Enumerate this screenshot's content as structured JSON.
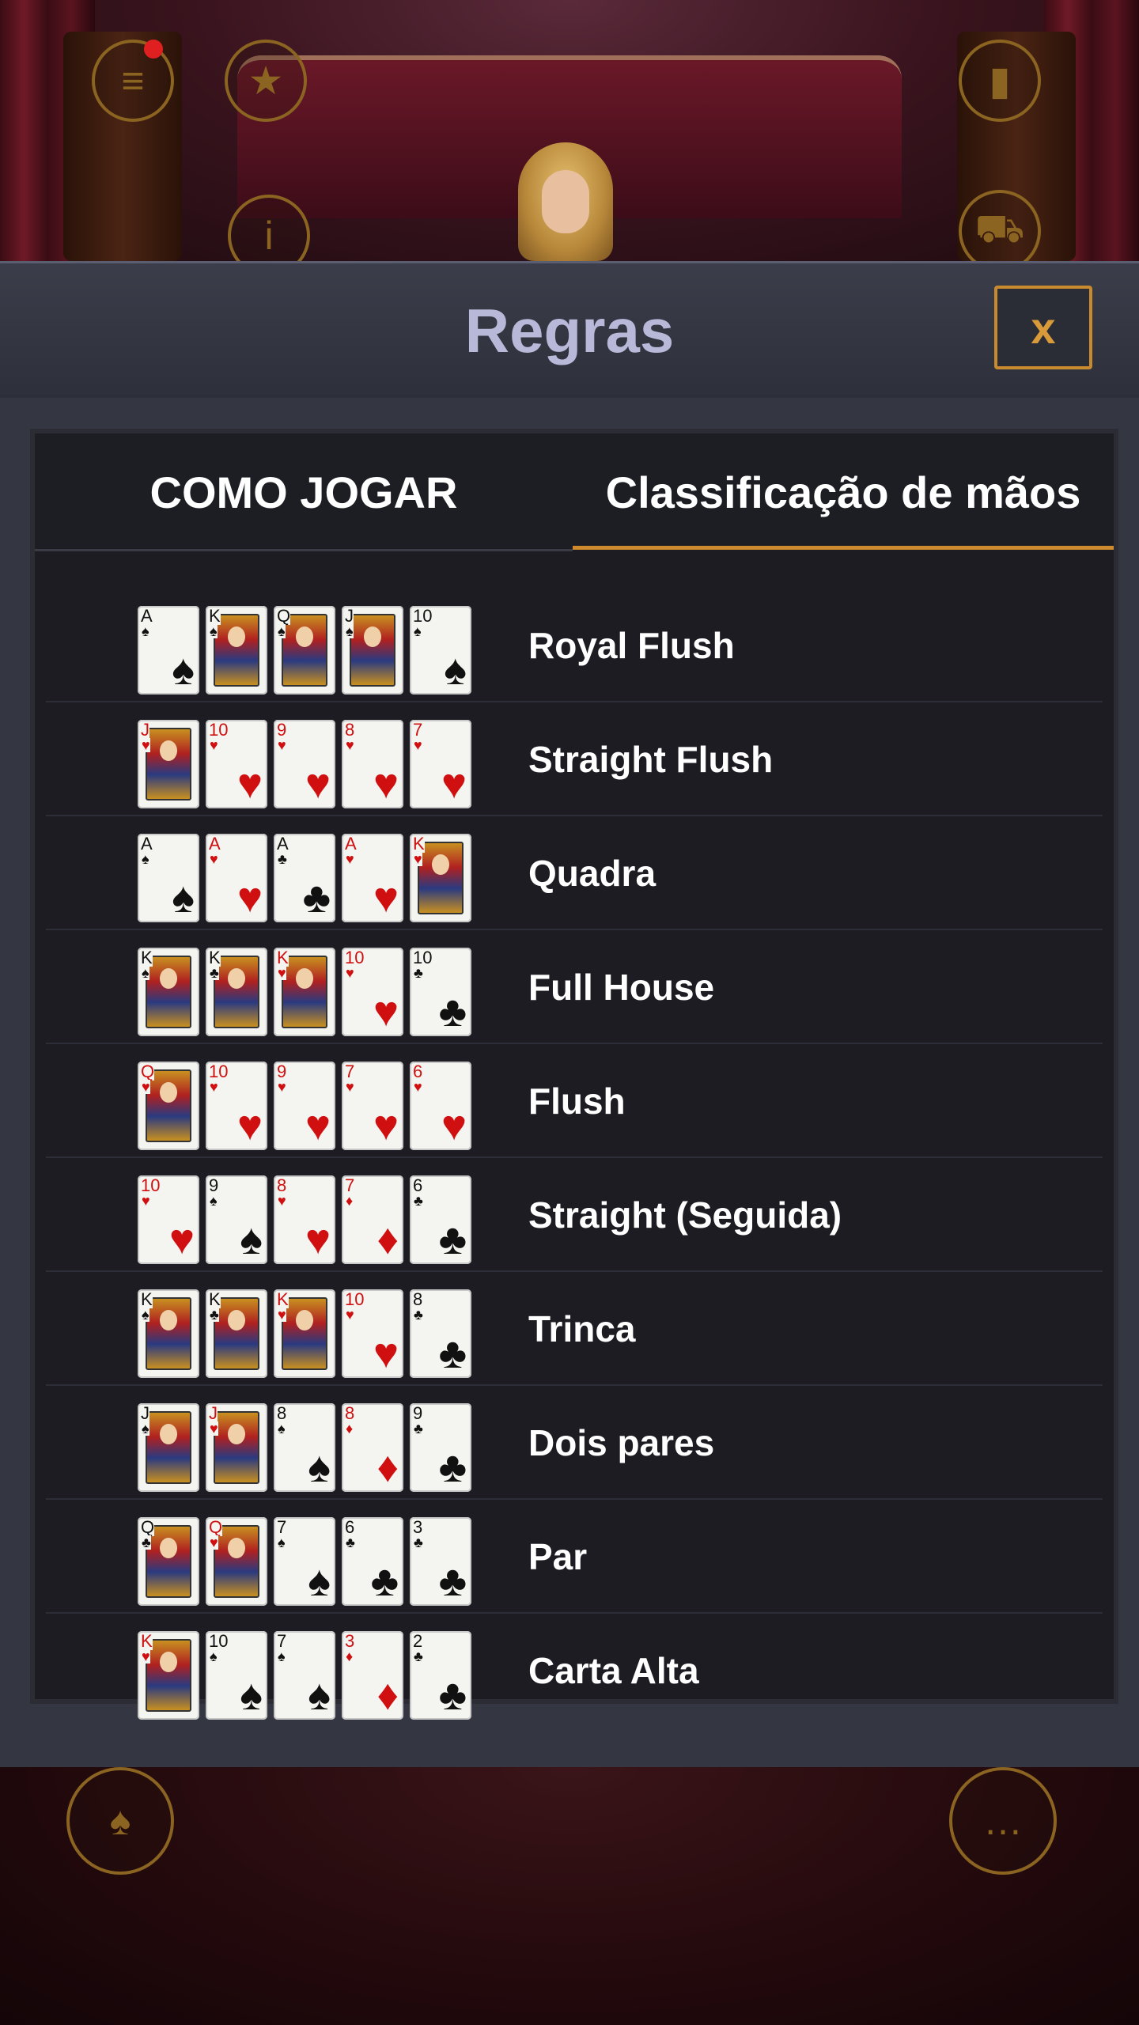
{
  "modal": {
    "title": "Regras",
    "close_label": "x"
  },
  "tabs": [
    {
      "label": "COMO JOGAR",
      "active": false
    },
    {
      "label": "Classificação de mãos",
      "active": true
    }
  ],
  "colors": {
    "accent": "#d08a2e",
    "title": "#b8b8d8",
    "card_red": "#d01010",
    "card_black": "#111111"
  },
  "background_icons": [
    "menu-icon",
    "favorites-icon",
    "stats-icon",
    "info-icon",
    "cart-icon",
    "cards-icon",
    "chat-icon"
  ],
  "hands": [
    {
      "name": "Royal Flush",
      "cards": [
        [
          "A",
          "♠"
        ],
        [
          "K",
          "♠"
        ],
        [
          "Q",
          "♠"
        ],
        [
          "J",
          "♠"
        ],
        [
          "10",
          "♠"
        ]
      ]
    },
    {
      "name": "Straight Flush",
      "cards": [
        [
          "J",
          "♥"
        ],
        [
          "10",
          "♥"
        ],
        [
          "9",
          "♥"
        ],
        [
          "8",
          "♥"
        ],
        [
          "7",
          "♥"
        ]
      ]
    },
    {
      "name": "Quadra",
      "cards": [
        [
          "A",
          "♠"
        ],
        [
          "A",
          "♥"
        ],
        [
          "A",
          "♣"
        ],
        [
          "A",
          "♥"
        ],
        [
          "K",
          "♥"
        ]
      ]
    },
    {
      "name": "Full House",
      "cards": [
        [
          "K",
          "♠"
        ],
        [
          "K",
          "♣"
        ],
        [
          "K",
          "♥"
        ],
        [
          "10",
          "♥"
        ],
        [
          "10",
          "♣"
        ]
      ]
    },
    {
      "name": "Flush",
      "cards": [
        [
          "Q",
          "♥"
        ],
        [
          "10",
          "♥"
        ],
        [
          "9",
          "♥"
        ],
        [
          "7",
          "♥"
        ],
        [
          "6",
          "♥"
        ]
      ]
    },
    {
      "name": "Straight (Seguida)",
      "cards": [
        [
          "10",
          "♥"
        ],
        [
          "9",
          "♠"
        ],
        [
          "8",
          "♥"
        ],
        [
          "7",
          "♦"
        ],
        [
          "6",
          "♣"
        ]
      ]
    },
    {
      "name": "Trinca",
      "cards": [
        [
          "K",
          "♠"
        ],
        [
          "K",
          "♣"
        ],
        [
          "K",
          "♥"
        ],
        [
          "10",
          "♥"
        ],
        [
          "8",
          "♣"
        ]
      ]
    },
    {
      "name": "Dois pares",
      "cards": [
        [
          "J",
          "♠"
        ],
        [
          "J",
          "♥"
        ],
        [
          "8",
          "♠"
        ],
        [
          "8",
          "♦"
        ],
        [
          "9",
          "♣"
        ]
      ]
    },
    {
      "name": "Par",
      "cards": [
        [
          "Q",
          "♣"
        ],
        [
          "Q",
          "♥"
        ],
        [
          "7",
          "♠"
        ],
        [
          "6",
          "♣"
        ],
        [
          "3",
          "♣"
        ]
      ]
    },
    {
      "name": "Carta Alta",
      "cards": [
        [
          "K",
          "♥"
        ],
        [
          "10",
          "♠"
        ],
        [
          "7",
          "♠"
        ],
        [
          "3",
          "♦"
        ],
        [
          "2",
          "♣"
        ]
      ]
    }
  ]
}
